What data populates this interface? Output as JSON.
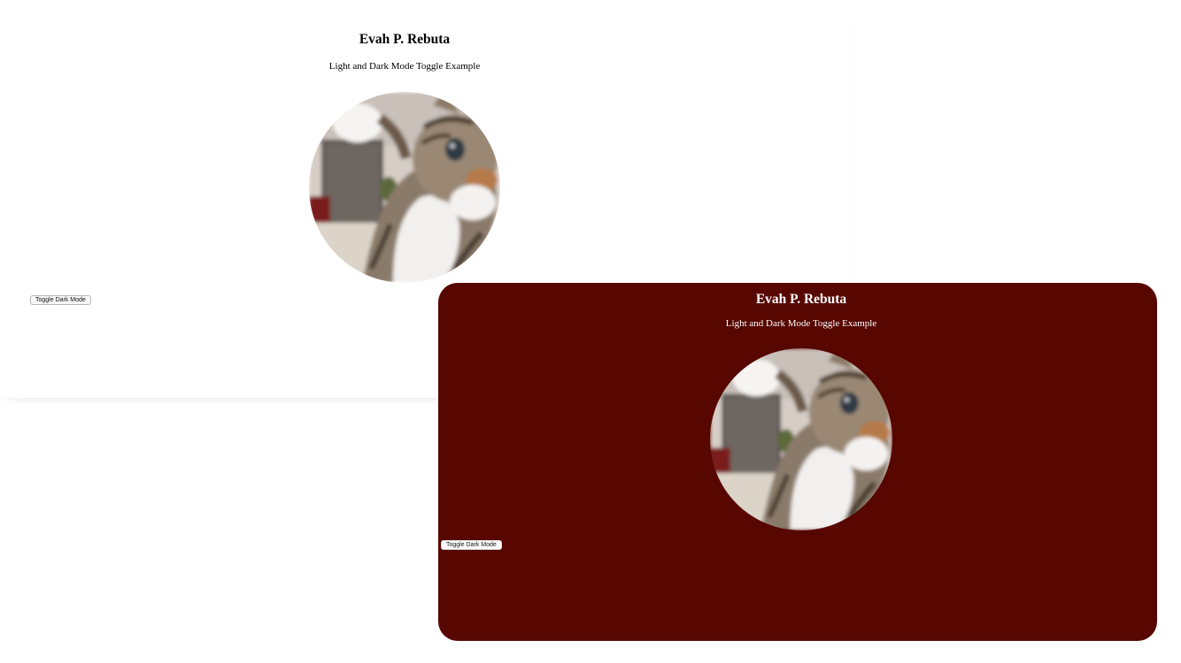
{
  "light_window": {
    "title": "Evah P. Rebuta",
    "subtitle": "Light and Dark Mode Toggle Example",
    "toggle_label": "Toggle Dark Mode",
    "photo_icon": "cat-photo-icon",
    "background": "#ffffff",
    "text_color": "#000000"
  },
  "dark_window": {
    "title": "Evah P. Rebuta",
    "subtitle": "Light and Dark Mode Toggle Example",
    "toggle_label": "Toggle Dark Mode",
    "photo_icon": "cat-photo-icon",
    "background": "#570700",
    "text_color": "#ffffff"
  }
}
